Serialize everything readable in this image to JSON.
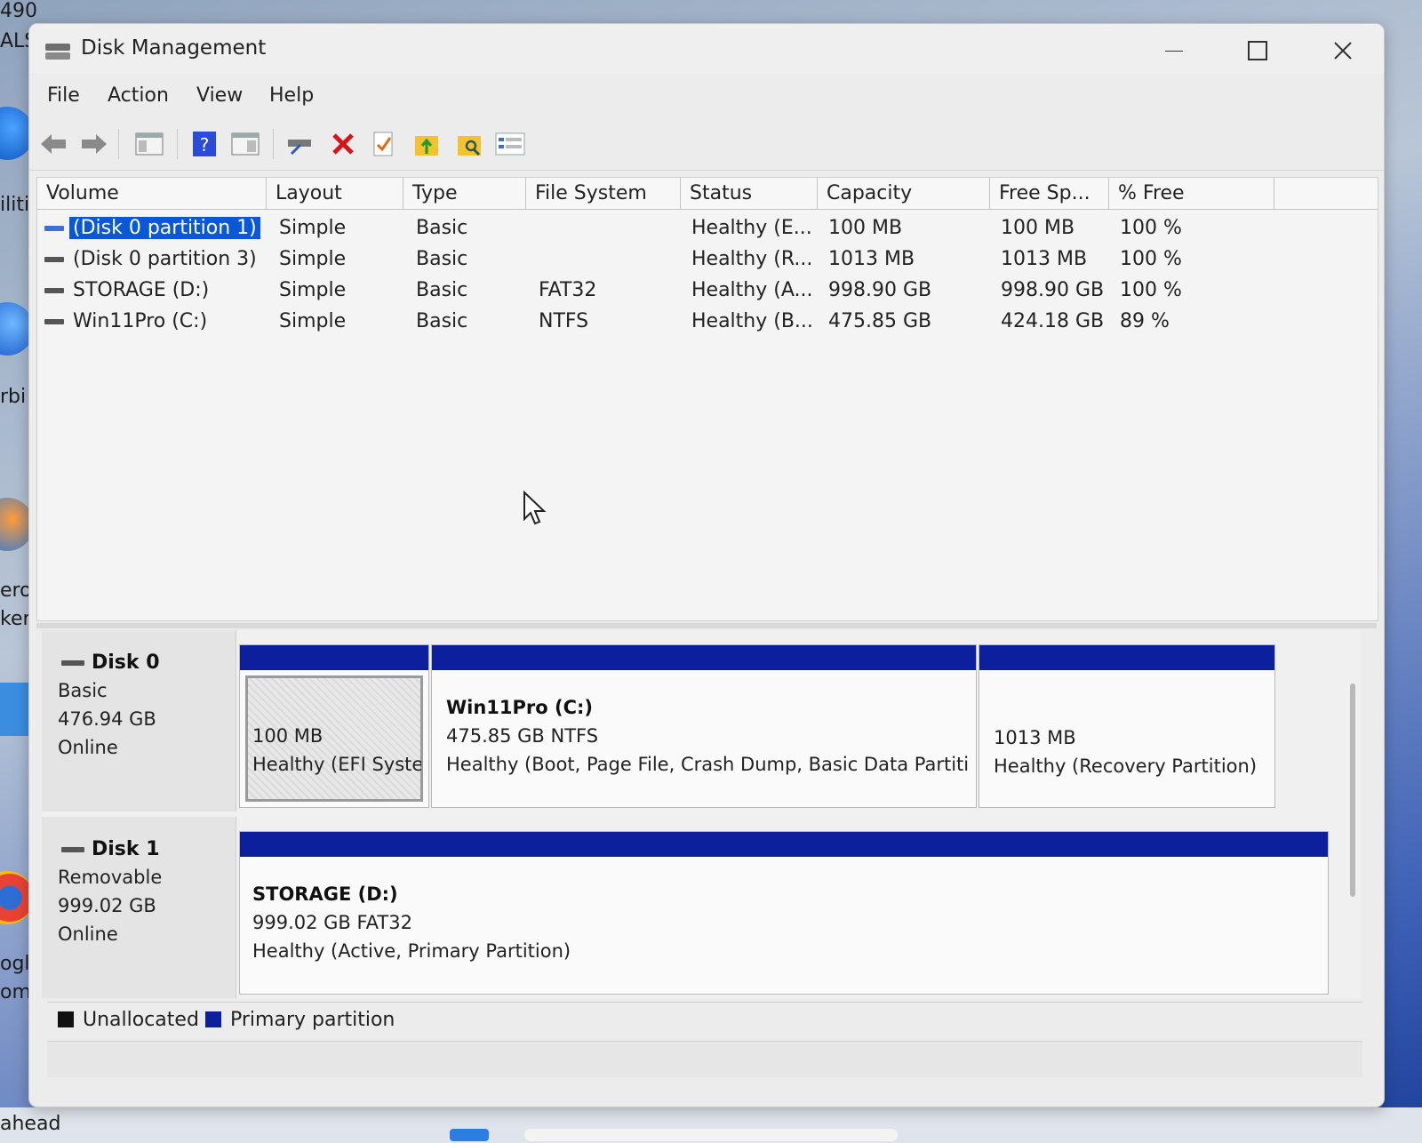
{
  "desktop": {
    "labels": [
      "490",
      "ALS",
      "iliti",
      "rbi",
      "ero",
      "ker",
      "ogle",
      "ome"
    ],
    "taskbar_label": "ahead"
  },
  "window": {
    "title": "Disk Management",
    "icon": "disk-management-icon"
  },
  "menu": [
    "File",
    "Action",
    "View",
    "Help"
  ],
  "toolbar": {
    "icons": [
      "back-arrow-icon",
      "forward-arrow-icon",
      "console-tree-icon",
      "help-icon",
      "show-pane-icon",
      "connect-drive-icon",
      "delete-icon",
      "check-icon",
      "folder-up-icon",
      "folder-search-icon",
      "properties-icon"
    ]
  },
  "volume_list": {
    "columns": [
      "Volume",
      "Layout",
      "Type",
      "File System",
      "Status",
      "Capacity",
      "Free Sp...",
      "% Free"
    ],
    "rows": [
      [
        "(Disk 0 partition 1)",
        "Simple",
        "Basic",
        "",
        "Healthy (E...",
        "100 MB",
        "100 MB",
        "100 %"
      ],
      [
        "(Disk 0 partition 3)",
        "Simple",
        "Basic",
        "",
        "Healthy (R...",
        "1013 MB",
        "1013 MB",
        "100 %"
      ],
      [
        "STORAGE (D:)",
        "Simple",
        "Basic",
        "FAT32",
        "Healthy (A...",
        "998.90 GB",
        "998.90 GB",
        "100 %"
      ],
      [
        "Win11Pro (C:)",
        "Simple",
        "Basic",
        "NTFS",
        "Healthy (B...",
        "475.85 GB",
        "424.18 GB",
        "89 %"
      ]
    ],
    "selected_row": 0
  },
  "disks": [
    {
      "name": "Disk 0",
      "type": "Basic",
      "size": "476.94 GB",
      "state": "Online",
      "partitions": [
        {
          "name": "",
          "size": "100 MB",
          "status": "Healthy (EFI Syste"
        },
        {
          "name": "Win11Pro  (C:)",
          "size": "475.85 GB NTFS",
          "status": "Healthy (Boot, Page File, Crash Dump, Basic Data Partiti"
        },
        {
          "name": "",
          "size": "1013 MB",
          "status": "Healthy (Recovery Partition)"
        }
      ]
    },
    {
      "name": "Disk 1",
      "type": "Removable",
      "size": "999.02 GB",
      "state": "Online",
      "partitions": [
        {
          "name": "STORAGE  (D:)",
          "size": "999.02 GB FAT32",
          "status": "Healthy (Active, Primary Partition)"
        }
      ]
    }
  ],
  "legend": [
    {
      "label": "Unallocated",
      "color": "#111111"
    },
    {
      "label": "Primary partition",
      "color": "#0c1f9c"
    }
  ],
  "colors": {
    "primary_partition": "#0c1f9c",
    "selection": "#0a58d6"
  }
}
